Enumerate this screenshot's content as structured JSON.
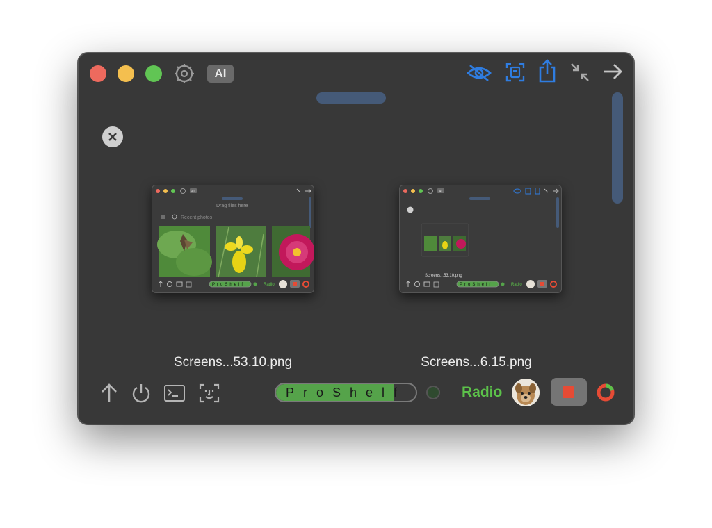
{
  "toolbar": {
    "ai_label": "AI",
    "icons": [
      "settings-icon",
      "hide-icon",
      "screenshot-icon",
      "share-icon",
      "collapse-icon",
      "forward-arrow-icon"
    ],
    "accent_color": "#2f7de1"
  },
  "files": [
    {
      "name": "Screens...53.10.png",
      "preview": "screenshot of app window showing Recent photos"
    },
    {
      "name": "Screens...6.15.png",
      "preview": "screenshot of app window showing nested screenshot"
    }
  ],
  "preview_1": {
    "drop_text": "Drag files here",
    "recent_label": "Recent photos",
    "shelf_label": "ProShelf",
    "radio_label": "Radio"
  },
  "preview_2": {
    "file_caption": "Screens...53.10.png",
    "shelf_label": "ProShelf",
    "radio_label": "Radio"
  },
  "footer": {
    "shelf_label": "ProShelf",
    "radio_label": "Radio",
    "colors": {
      "shelf_green": "#55a34a",
      "radio_green": "#5cc14a",
      "stop_red": "#e64b35"
    }
  }
}
